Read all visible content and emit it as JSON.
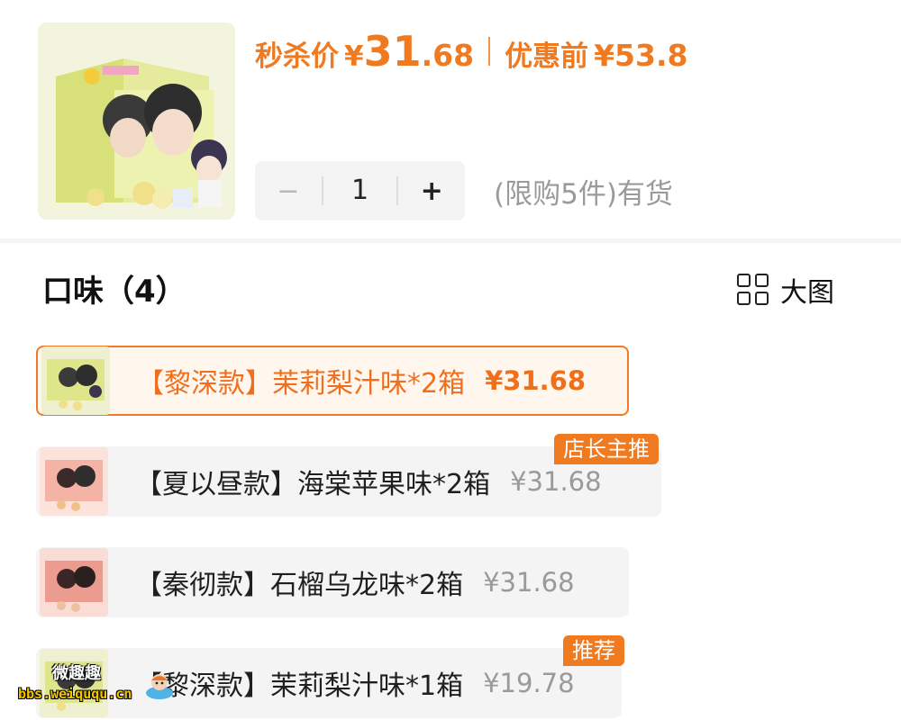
{
  "header": {
    "sale_label": "秒杀价",
    "currency": "¥",
    "sale_price_int": "31",
    "sale_price_dec": ".68",
    "original_label": "优惠前",
    "original_price": "¥53.8"
  },
  "quantity": {
    "minus": "−",
    "value": "1",
    "plus": "+",
    "stock_note": "(限购5件)有货"
  },
  "flavors": {
    "title": "口味（4）",
    "view_toggle_label": "大图",
    "options": [
      {
        "name": "【黎深款】茉莉梨汁味*2箱",
        "price": "¥31.68",
        "selected": true,
        "badge": ""
      },
      {
        "name": "【夏以昼款】海棠苹果味*2箱",
        "price": "¥31.68",
        "selected": false,
        "badge": "店长主推"
      },
      {
        "name": "【秦彻款】石榴乌龙味*2箱",
        "price": "¥31.68",
        "selected": false,
        "badge": ""
      },
      {
        "name": "【黎深款】茉莉梨汁味*1箱",
        "price": "¥19.78",
        "selected": false,
        "badge": "推荐"
      }
    ]
  },
  "watermark": {
    "line1": "微趣趣",
    "line2": "bbs.weiququ.cn"
  },
  "colors": {
    "accent": "#F07A20",
    "muted": "#9A9A9A",
    "option_bg": "#F4F4F5"
  }
}
